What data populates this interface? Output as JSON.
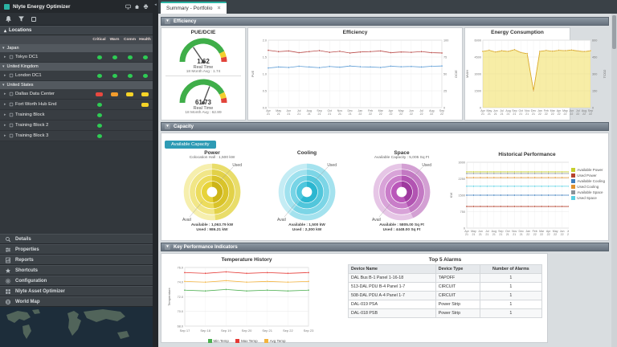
{
  "status_colors": {
    "green": "#2ecc54",
    "red": "#e8483f",
    "orange": "#f39c2c",
    "yellow": "#f5d327",
    "none": "transparent"
  },
  "sidebar": {
    "title": "Nlyte Energy Optimizer",
    "locations_label": "Locations",
    "columns": [
      "Critical",
      "Warn",
      "Comm",
      "Health"
    ],
    "groups": [
      {
        "name": "Japan",
        "rows": [
          {
            "name": "Tokyo DC1",
            "status": [
              "green",
              "green",
              "green",
              "green"
            ]
          }
        ]
      },
      {
        "name": "United Kingdom",
        "rows": [
          {
            "name": "London DC1",
            "status": [
              "green",
              "green",
              "green",
              "green"
            ]
          }
        ]
      },
      {
        "name": "United States",
        "rows": [
          {
            "name": "Dallas Data Center",
            "status": [
              "red",
              "orange",
              "yellow",
              "yellow"
            ]
          },
          {
            "name": "Fort Worth Hub End",
            "status": [
              "green",
              "none",
              "none",
              "yellow"
            ]
          },
          {
            "name": "Training Block",
            "status": [
              "green",
              "none",
              "none",
              "none"
            ]
          },
          {
            "name": "Training Block 2",
            "status": [
              "green",
              "none",
              "none",
              "none"
            ]
          },
          {
            "name": "Training Block 3",
            "status": [
              "green",
              "none",
              "none",
              "none"
            ]
          }
        ]
      }
    ],
    "accordion": [
      "Details",
      "Properties",
      "Reports",
      "Shortcuts",
      "Configuration",
      "Nlyte Asset Optimizer",
      "World Map"
    ]
  },
  "tabs": [
    {
      "label": "Summary - Portfolio"
    }
  ],
  "sections": {
    "efficiency": "Efficiency",
    "capacity": "Capacity",
    "kpi": "Key Performance Indicators"
  },
  "capacity_button": "Available Capacity",
  "gauges": {
    "title": "PUE/DCIE",
    "pue": {
      "value": "1.62",
      "caption": "Real Time",
      "avg": "18 Month Avg : 1.74"
    },
    "dcie": {
      "value": "61.73",
      "caption": "Real Time",
      "avg": "18 Month Avg : 62.89"
    }
  },
  "capacity": {
    "power": {
      "title": "Power",
      "subtitle": "Colocation Hall : 1,500 kW",
      "available": "Available : 1,063.79 kW",
      "used": "Used : 986.21 kW"
    },
    "cooling": {
      "title": "Cooling",
      "subtitle": "",
      "available": "Available : 1,500 kW",
      "used": "Used : 2,300 kW"
    },
    "space": {
      "title": "Space",
      "subtitle": "Available Capacity : 5,005 Sq Ft",
      "available": "Available : 5805.00 Sq Ft",
      "used": "Used : 4448.00 Sq Ft"
    }
  },
  "alarms": {
    "title": "Top 5 Alarms",
    "columns": [
      "Device Name",
      "Device Type",
      "Number of Alarms"
    ],
    "rows": [
      [
        "DAL Bus B-1 Panel 1-16-18",
        "TAPOFF",
        "1"
      ],
      [
        "513-DAL PDU B-4 Panel 1-7",
        "CIRCUIT",
        "1"
      ],
      [
        "508-DAL PDU A-4 Panel 1-7",
        "CIRCUIT",
        "1"
      ],
      [
        "DAL-019 PSA",
        "Power Strip",
        "1"
      ],
      [
        "DAL-018 PSB",
        "Power Strip",
        "1"
      ]
    ]
  },
  "chart_data": [
    {
      "id": "efficiency",
      "type": "line",
      "title": "Efficiency",
      "x_stack": true,
      "x": [
        "Apr 21",
        "May 21",
        "Jun 21",
        "Jul 21",
        "Aug 21",
        "Sep 21",
        "Oct 21",
        "Nov 21",
        "Dec 21",
        "Jan 22",
        "Feb 22",
        "Mar 22",
        "Apr 22",
        "May 22",
        "Jun 22",
        "Jul 22",
        "Aug 22",
        "Sep 22"
      ],
      "ylim_left": [
        0,
        2
      ],
      "ylim_right": [
        0,
        100
      ],
      "ylabel_left": "PUE",
      "ylabel_right": "DCIE",
      "series": [
        {
          "name": "PUE",
          "axis": "left",
          "color": "#b94a48",
          "values": [
            1.7,
            1.66,
            1.68,
            1.63,
            1.66,
            1.69,
            1.64,
            1.67,
            1.62,
            1.65,
            1.66,
            1.68,
            1.63,
            1.65,
            1.64,
            1.66,
            1.63,
            1.62
          ]
        },
        {
          "name": "DCIE",
          "axis": "right",
          "color": "#5b9bd5",
          "values": [
            58.8,
            60.2,
            59.5,
            61.3,
            60.2,
            59.2,
            61.0,
            59.9,
            61.7,
            60.6,
            60.2,
            59.5,
            61.4,
            60.6,
            61.0,
            60.2,
            61.3,
            61.7
          ]
        }
      ]
    },
    {
      "id": "energy",
      "type": "line",
      "title": "Energy Consumption",
      "x_stack": true,
      "x": [
        "Apr 21",
        "May 21",
        "Jun 21",
        "Jul 21",
        "Aug 21",
        "Sep 21",
        "Oct 21",
        "Nov 21",
        "Dec 21",
        "Jan 22",
        "Feb 22",
        "Mar 22",
        "Apr 22",
        "May 22",
        "Jun 22",
        "Jul 22",
        "Aug 22",
        "Sep 22"
      ],
      "ylim_left": [
        0,
        6000
      ],
      "ylim_right": [
        0,
        600
      ],
      "ylabel_left": "MWH",
      "ylabel_right": "TCO2",
      "series": [
        {
          "name": "MWH",
          "axis": "left",
          "color": "#f0dc4e",
          "area": true,
          "values": [
            5000,
            5100,
            4950,
            5050,
            5000,
            5150,
            4900,
            4800,
            1500,
            5000,
            5080,
            5020,
            5100,
            5060,
            5120,
            5040,
            4980,
            5050
          ]
        },
        {
          "name": "TCO2",
          "axis": "right",
          "color": "#d9a62e",
          "values": [
            500,
            510,
            495,
            505,
            500,
            515,
            490,
            480,
            150,
            500,
            508,
            502,
            510,
            506,
            512,
            504,
            498,
            505
          ]
        }
      ]
    },
    {
      "id": "historical",
      "type": "line",
      "title": "Historical Performance",
      "x_stack": true,
      "x": [
        "Apr 21",
        "May 21",
        "Jun 21",
        "Jul 21",
        "Aug 21",
        "Sep 21",
        "Oct 21",
        "Nov 21",
        "Dec 21",
        "Jan 22",
        "Feb 22",
        "Mar 22",
        "Apr 22",
        "May 22",
        "Jun 22",
        "Jul 22",
        "Aug 22",
        "Sep 22"
      ],
      "ylim_left": [
        0,
        3000
      ],
      "ylim_right": [
        0,
        7000
      ],
      "ylabel_left": "KW",
      "ylabel_right": "Sq Ft",
      "series": [
        {
          "name": "Available Power",
          "axis": "left",
          "color": "#c6cf2d",
          "flat": 2563
        },
        {
          "name": "Used Power",
          "axis": "left",
          "color": "#b5432f",
          "flat": 986
        },
        {
          "name": "Available Cooling",
          "axis": "left",
          "color": "#3f7fbf",
          "flat": 1500
        },
        {
          "name": "Used Cooling",
          "axis": "left",
          "color": "#e0912f",
          "flat": 2300
        },
        {
          "name": "Available Space",
          "axis": "right",
          "color": "#8a9298",
          "flat": 5805
        },
        {
          "name": "Used Space",
          "axis": "right",
          "color": "#59d1e3",
          "flat": 4448
        }
      ]
    },
    {
      "id": "temperature",
      "type": "line",
      "title": "Temperature History",
      "x_stack": false,
      "x": [
        "Sep 17",
        "Sep 18",
        "Sep 19",
        "Sep 20",
        "Sep 21",
        "Sep 22",
        "Sep 23"
      ],
      "ylim_left": [
        68,
        76
      ],
      "ylabel_left": "Temperature",
      "series": [
        {
          "name": "Min Temp",
          "axis": "left",
          "color": "#4caf50",
          "values": [
            72.9,
            72.8,
            73.0,
            72.8,
            72.9,
            72.8,
            72.9
          ]
        },
        {
          "name": "Max Temp",
          "axis": "left",
          "color": "#e53935",
          "values": [
            75.3,
            75.2,
            75.4,
            75.2,
            75.3,
            75.2,
            75.3
          ]
        },
        {
          "name": "Avg Temp",
          "axis": "left",
          "color": "#f3b33d",
          "values": [
            74.1,
            74.0,
            74.2,
            74.0,
            74.1,
            74.0,
            74.1
          ]
        }
      ]
    },
    {
      "id": "donut-power",
      "type": "donut",
      "used_frac": 0.481,
      "used_label": "Used",
      "avail_label": "Avail",
      "ring_colors": [
        "#f6efae",
        "#f1e687",
        "#ecdc5d",
        "#e7d339"
      ],
      "used_colors": [
        "#e9dd6b",
        "#e2d148",
        "#d9c32a",
        "#cdb417"
      ]
    },
    {
      "id": "donut-cooling",
      "type": "donut",
      "used_frac": 0.605,
      "used_label": "Used",
      "avail_label": "Avail",
      "ring_colors": [
        "#c4ecf4",
        "#9fe1ee",
        "#77d4e6",
        "#4fc7de"
      ],
      "used_colors": [
        "#a4e2ee",
        "#7cd5e6",
        "#52c6db",
        "#2bb6d0"
      ]
    },
    {
      "id": "donut-space",
      "type": "donut",
      "used_frac": 0.434,
      "used_label": "Used",
      "avail_label": "Avail",
      "ring_colors": [
        "#e6c6e6",
        "#d8a3d8",
        "#c97dc9",
        "#ba57ba"
      ],
      "used_colors": [
        "#d3a0d3",
        "#c379c3",
        "#b254b2",
        "#9e3a9e"
      ]
    },
    {
      "id": "gauge-pue",
      "type": "gauge",
      "min": 1,
      "max": 3,
      "value": 1.62
    },
    {
      "id": "gauge-dcie",
      "type": "gauge",
      "min": 0,
      "max": 100,
      "value": 61.73
    }
  ]
}
